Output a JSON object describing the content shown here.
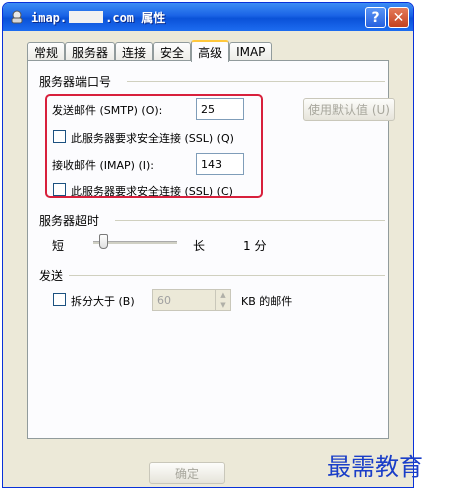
{
  "window": {
    "title_prefix": "imap.",
    "title_suffix": ".com 属性",
    "help_label": "?",
    "close_label": "✕"
  },
  "tabs": [
    {
      "label": "常规",
      "active": false
    },
    {
      "label": "服务器",
      "active": false
    },
    {
      "label": "连接",
      "active": false
    },
    {
      "label": "安全",
      "active": false
    },
    {
      "label": "高级",
      "active": true
    },
    {
      "label": "IMAP",
      "active": false
    }
  ],
  "ports": {
    "group_title": "服务器端口号",
    "smtp_label": "发送邮件 (SMTP) (O):",
    "smtp_value": "25",
    "use_default_label": "使用默认值 (U)",
    "smtp_ssl_label": "此服务器要求安全连接 (SSL) (Q)",
    "smtp_ssl_checked": false,
    "imap_label": "接收邮件 (IMAP) (I):",
    "imap_value": "143",
    "imap_ssl_label": "此服务器要求安全连接 (SSL) (C)",
    "imap_ssl_checked": false
  },
  "timeout": {
    "group_title": "服务器超时",
    "short_label": "短",
    "long_label": "长",
    "value_label": "1 分",
    "slider_fraction": 0.08
  },
  "sending": {
    "group_title": "发送",
    "split_label": "拆分大于 (B)",
    "split_checked": false,
    "split_value": "60",
    "unit_label": "KB 的邮件"
  },
  "footer": {
    "ok_label": "确定"
  },
  "watermark": "最需教育",
  "colors": {
    "highlight": "#d8203c",
    "titlebar": "#0a52d8",
    "watermark": "#1a3ec8"
  }
}
